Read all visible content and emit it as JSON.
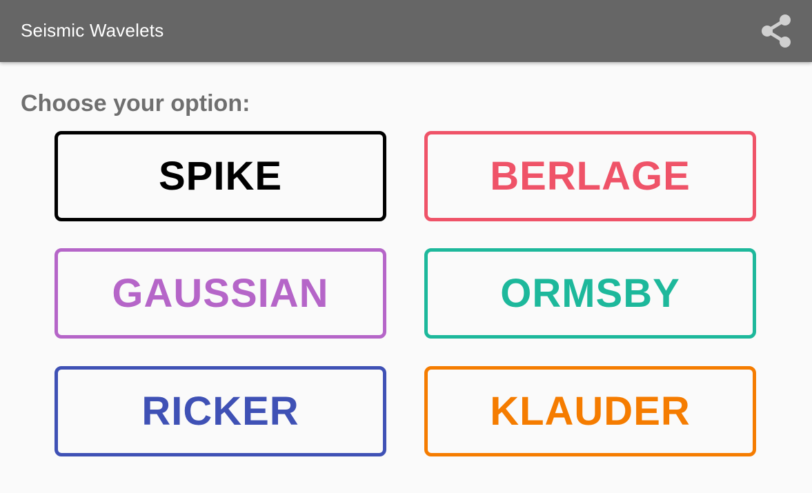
{
  "app_bar": {
    "title": "Seismic Wavelets",
    "share_icon": "share-icon",
    "background": "#666666",
    "title_color": "#ffffff"
  },
  "content": {
    "prompt": "Choose your option:",
    "prompt_color": "#6f6f6f"
  },
  "options": [
    {
      "label": "SPIKE",
      "color": "#000000"
    },
    {
      "label": "BERLAGE",
      "color": "#ef5368"
    },
    {
      "label": "GAUSSIAN",
      "color": "#b565c8"
    },
    {
      "label": "ORMSBY",
      "color": "#1db89b"
    },
    {
      "label": "RICKER",
      "color": "#3f51b5"
    },
    {
      "label": "KLAUDER",
      "color": "#f57c00"
    }
  ]
}
